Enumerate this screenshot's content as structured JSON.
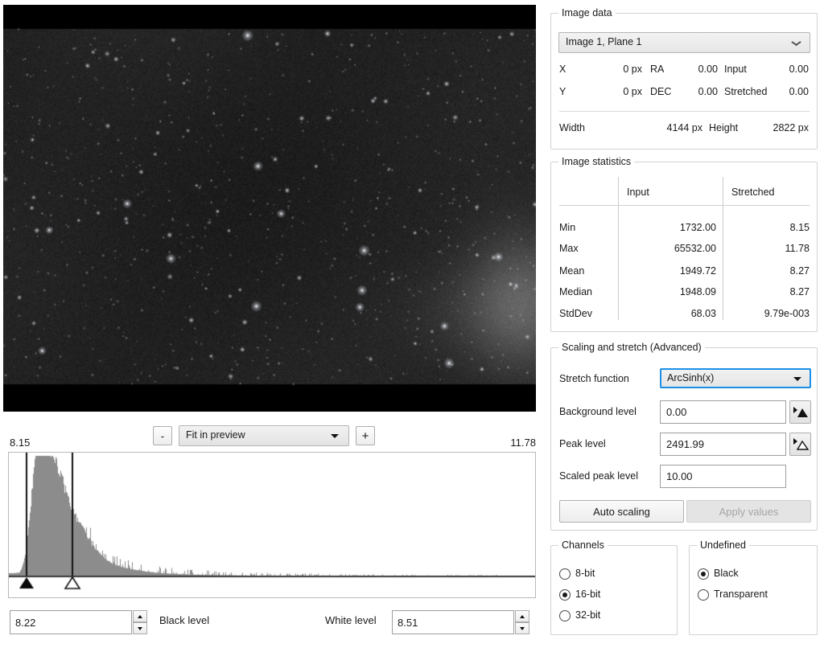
{
  "preview": {
    "zoom_minus_label": "-",
    "zoom_plus_label": "+",
    "zoom_mode": "Fit in preview"
  },
  "histogram": {
    "min_label": "8.15",
    "max_label": "11.78",
    "black_marker_pos": 0.0193,
    "white_marker_pos": 0.1076,
    "black_level_value": "8.22",
    "black_level_label": "Black level",
    "white_level_label": "White level",
    "white_level_value": "8.51"
  },
  "image_data": {
    "group_title": "Image data",
    "plane_selected": "Image 1, Plane 1",
    "x_label": "X",
    "x_value": "0 px",
    "y_label": "Y",
    "y_value": "0 px",
    "ra_label": "RA",
    "ra_value": "0.00",
    "dec_label": "DEC",
    "dec_value": "0.00",
    "input_label": "Input",
    "input_value": "0.00",
    "stretched_label": "Stretched",
    "stretched_value": "0.00",
    "width_label": "Width",
    "width_value": "4144 px",
    "height_label": "Height",
    "height_value": "2822 px"
  },
  "image_statistics": {
    "group_title": "Image statistics",
    "col_input": "Input",
    "col_stretched": "Stretched",
    "rows": [
      {
        "name": "Min",
        "input": "1732.00",
        "stretched": "8.15"
      },
      {
        "name": "Max",
        "input": "65532.00",
        "stretched": "11.78"
      },
      {
        "name": "Mean",
        "input": "1949.72",
        "stretched": "8.27"
      },
      {
        "name": "Median",
        "input": "1948.09",
        "stretched": "8.27"
      },
      {
        "name": "StdDev",
        "input": "68.03",
        "stretched": "9.79e-003"
      }
    ]
  },
  "scaling": {
    "group_title": "Scaling and stretch (Advanced)",
    "stretch_function_label": "Stretch function",
    "stretch_function_value": "ArcSinh(x)",
    "background_level_label": "Background level",
    "background_level_value": "0.00",
    "peak_level_label": "Peak level",
    "peak_level_value": "2491.99",
    "scaled_peak_level_label": "Scaled peak level",
    "scaled_peak_level_value": "10.00",
    "auto_scaling_label": "Auto scaling",
    "apply_values_label": "Apply values"
  },
  "channels": {
    "group_title": "Channels",
    "options": [
      {
        "label": "8-bit",
        "selected": false
      },
      {
        "label": "16-bit",
        "selected": true
      },
      {
        "label": "32-bit",
        "selected": false
      }
    ]
  },
  "undefined_panel": {
    "group_title": "Undefined",
    "options": [
      {
        "label": "Black",
        "selected": true
      },
      {
        "label": "Transparent",
        "selected": false
      }
    ]
  },
  "colors": {
    "accent_focus": "#1c8fe8",
    "panel_bg": "#ffffff",
    "image_bg": "#000000",
    "histogram_fill": "#8c8c8c"
  }
}
